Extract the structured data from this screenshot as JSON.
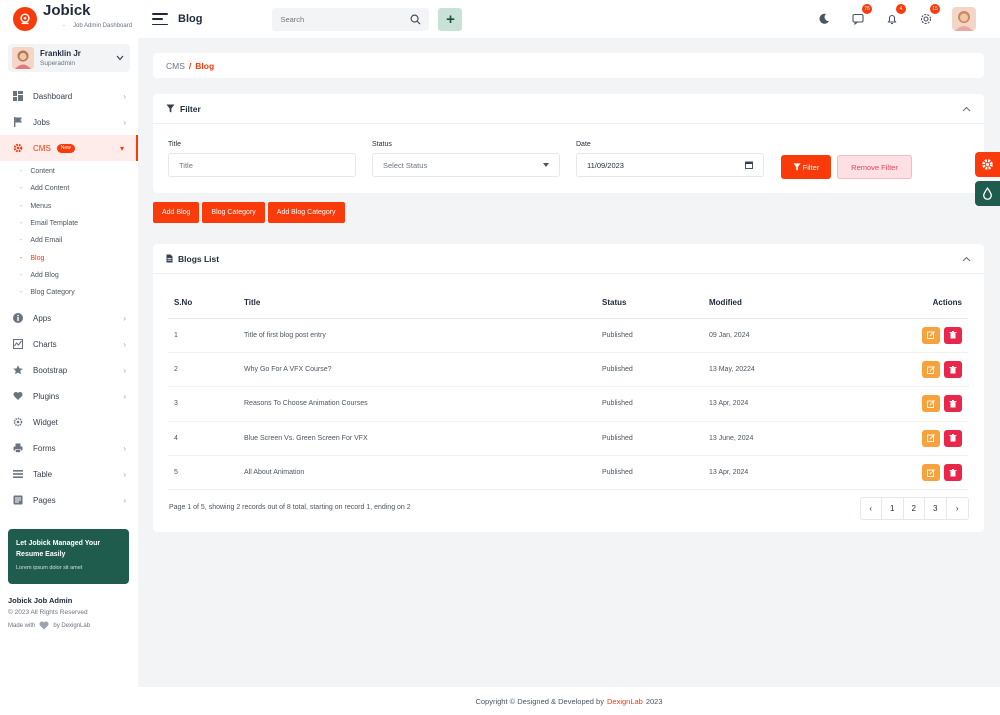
{
  "brand": {
    "name": "Jobick",
    "subtitle": "Job Admin Dashboard"
  },
  "header": {
    "title": "Blog",
    "search_placeholder": "Search",
    "plus_label": "+",
    "badges": {
      "messages": "76",
      "notifications": "4",
      "settings": "15"
    }
  },
  "user": {
    "name": "Franklin Jr",
    "role": "Superadmin"
  },
  "sidebar": {
    "items": [
      {
        "label": "Dashboard",
        "icon": "dashboard-icon",
        "arrow": "›"
      },
      {
        "label": "Jobs",
        "icon": "flag-icon",
        "arrow": "›"
      },
      {
        "label": "CMS",
        "icon": "gear-icon",
        "badge": "New",
        "arrow": "▾"
      },
      {
        "label": "Apps",
        "icon": "info-icon",
        "arrow": "›"
      },
      {
        "label": "Charts",
        "icon": "chart-icon",
        "arrow": "›"
      },
      {
        "label": "Bootstrap",
        "icon": "star-icon",
        "arrow": "›"
      },
      {
        "label": "Plugins",
        "icon": "heart-icon",
        "arrow": "›"
      },
      {
        "label": "Widget",
        "icon": "widget-icon",
        "arrow": ""
      },
      {
        "label": "Forms",
        "icon": "printer-icon",
        "arrow": "›"
      },
      {
        "label": "Table",
        "icon": "table-icon",
        "arrow": "›"
      },
      {
        "label": "Pages",
        "icon": "pages-icon",
        "arrow": "›"
      }
    ],
    "cms_sub": [
      "Content",
      "Add Content",
      "Menus",
      "Email Template",
      "Add Email",
      "Blog",
      "Add Blog",
      "Blog Category"
    ],
    "promo": {
      "title": "Let Jobick Managed Your Resume Easily",
      "text": "Lorem ipsum dolor sit amet"
    },
    "footer": {
      "title": "Jobick Job Admin",
      "rights": "© 2023 All Rights Reserved",
      "made_with": "Made with",
      "by": "by DexignLab"
    }
  },
  "breadcrumb": {
    "root": "CMS",
    "sep": "/",
    "current": "Blog"
  },
  "filter": {
    "heading": "Filter",
    "title_label": "Title",
    "title_placeholder": "Title",
    "status_label": "Status",
    "status_value": "Select Status",
    "date_label": "Date",
    "date_value": "11/09/2023",
    "filter_btn": "Filter",
    "remove_btn": "Remove Filter"
  },
  "actions": {
    "add_blog": "Add Blog",
    "blog_category": "Blog Category",
    "add_blog_category": "Add Blog Category"
  },
  "list": {
    "heading": "Blogs List",
    "columns": {
      "sno": "S.No",
      "title": "Title",
      "status": "Status",
      "modified": "Modified",
      "actions": "Actions"
    },
    "rows": [
      {
        "sno": "1",
        "title": "Title of first blog post entry",
        "status": "Published",
        "modified": "09 Jan, 2024"
      },
      {
        "sno": "2",
        "title": "Why Go For A VFX Course?",
        "status": "Published",
        "modified": "13 May, 20224"
      },
      {
        "sno": "3",
        "title": "Reasons To Choose Animation Courses",
        "status": "Published",
        "modified": "13 Apr, 2024"
      },
      {
        "sno": "4",
        "title": "Blue Screen Vs. Green Screen For VFX",
        "status": "Published",
        "modified": "13 June, 2024"
      },
      {
        "sno": "5",
        "title": "All About Animation",
        "status": "Published",
        "modified": "13 Apr, 2024"
      }
    ],
    "page_info": "Page 1 of 5, showing 2 records out of 8 total, starting on record 1, ending on 2",
    "pages": [
      "1",
      "2",
      "3"
    ],
    "prev": "‹",
    "next": "›"
  },
  "footer": {
    "pre": "Copyright © Designed & Developed by",
    "brand": "DexignLab",
    "year": "2023"
  },
  "colors": {
    "accent": "#f93a0b",
    "dark_green": "#1f5c4d",
    "edit": "#f7a23c",
    "delete": "#e8274b"
  }
}
